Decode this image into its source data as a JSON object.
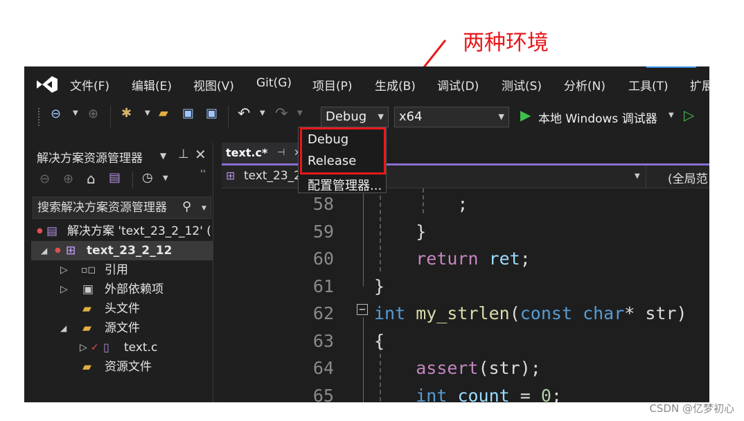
{
  "menu": {
    "items": [
      "文件(F)",
      "编辑(E)",
      "视图(V)",
      "Git(G)",
      "项目(P)",
      "生成(B)",
      "调试(D)",
      "测试(S)",
      "分析(N)",
      "工具(T)",
      "扩展"
    ]
  },
  "toolbar": {
    "configuration": "Debug",
    "platform": "x64",
    "debugger_label": "本地 Windows 调试器"
  },
  "dropdown": {
    "options": [
      "Debug",
      "Release"
    ],
    "manager": "配置管理器..."
  },
  "solution_explorer": {
    "title": "解决方案资源管理器",
    "search_placeholder": "搜索解决方案资源管理器",
    "tree": [
      "解决方案 'text_23_2_12' (",
      "text_23_2_12",
      "引用",
      "外部依赖项",
      "头文件",
      "源文件",
      "text.c",
      "资源文件"
    ]
  },
  "editor": {
    "tab_label": "text.c*",
    "nav_project": "text_23_2",
    "nav_scope": "(全局范",
    "lines": [
      {
        "num": "58",
        "parts": [
          {
            "t": "        ;",
            "c": "plain"
          }
        ]
      },
      {
        "num": "59",
        "parts": [
          {
            "t": "    }",
            "c": "plain"
          }
        ]
      },
      {
        "num": "60",
        "parts": [
          {
            "t": "    ",
            "c": "plain"
          },
          {
            "t": "return",
            "c": "ret"
          },
          {
            "t": " ",
            "c": "plain"
          },
          {
            "t": "ret",
            "c": "var"
          },
          {
            "t": ";",
            "c": "plain"
          }
        ]
      },
      {
        "num": "61",
        "parts": [
          {
            "t": "}",
            "c": "plain"
          }
        ]
      },
      {
        "num": "62",
        "parts": [
          {
            "t": "int",
            "c": "kw"
          },
          {
            "t": " ",
            "c": "plain"
          },
          {
            "t": "my_strlen",
            "c": "fn"
          },
          {
            "t": "(",
            "c": "plain"
          },
          {
            "t": "const",
            "c": "kw"
          },
          {
            "t": " ",
            "c": "plain"
          },
          {
            "t": "char",
            "c": "kw"
          },
          {
            "t": "* str)",
            "c": "plain"
          }
        ]
      },
      {
        "num": "63",
        "parts": [
          {
            "t": "{",
            "c": "plain"
          }
        ]
      },
      {
        "num": "64",
        "parts": [
          {
            "t": "    ",
            "c": "plain"
          },
          {
            "t": "assert",
            "c": "ret"
          },
          {
            "t": "(str);",
            "c": "plain"
          }
        ]
      },
      {
        "num": "65",
        "parts": [
          {
            "t": "    ",
            "c": "plain"
          },
          {
            "t": "int",
            "c": "kw"
          },
          {
            "t": " ",
            "c": "plain"
          },
          {
            "t": "count",
            "c": "var"
          },
          {
            "t": " = ",
            "c": "plain"
          },
          {
            "t": "0",
            "c": "num"
          },
          {
            "t": ";",
            "c": "plain"
          }
        ]
      }
    ]
  },
  "annotation": "两种环境",
  "watermark": "CSDN @亿梦初心",
  "colors": {
    "annotation": "#e8181b",
    "accent": "#8a6fd1"
  }
}
